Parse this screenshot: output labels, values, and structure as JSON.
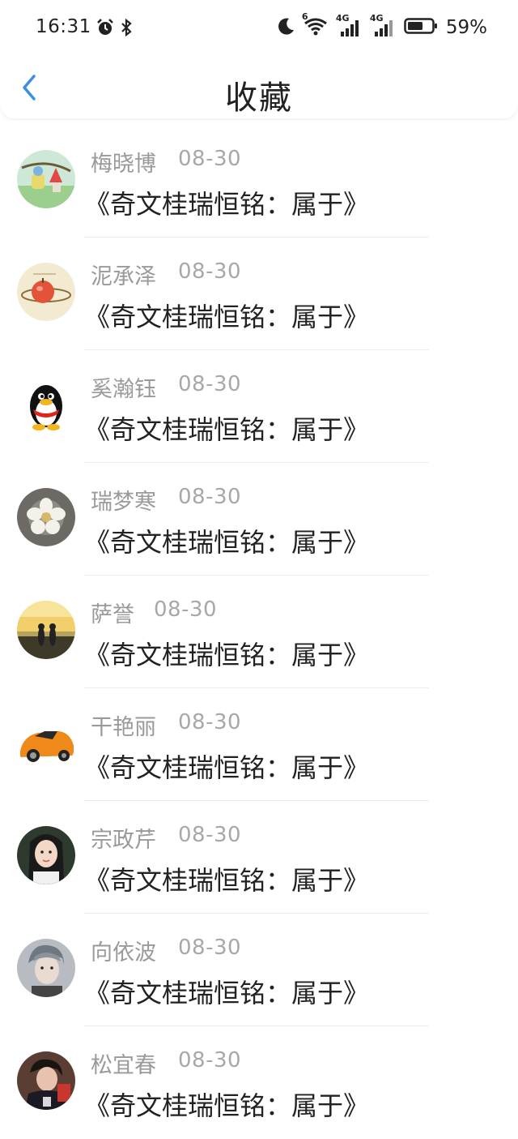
{
  "status_bar": {
    "time": "16:31",
    "battery": "59%",
    "network_1": "4G",
    "network_2": "4G",
    "wifi_label": "6"
  },
  "header": {
    "title": "收藏"
  },
  "items": [
    {
      "name": "梅晓博",
      "date": "08-30",
      "title": "《奇文桂瑞恒铭：属于》"
    },
    {
      "name": "泥承泽",
      "date": "08-30",
      "title": "《奇文桂瑞恒铭：属于》"
    },
    {
      "name": "奚瀚钰",
      "date": "08-30",
      "title": "《奇文桂瑞恒铭：属于》"
    },
    {
      "name": "瑞梦寒",
      "date": "08-30",
      "title": "《奇文桂瑞恒铭：属于》"
    },
    {
      "name": "萨誉",
      "date": "08-30",
      "title": "《奇文桂瑞恒铭：属于》"
    },
    {
      "name": "干艳丽",
      "date": "08-30",
      "title": "《奇文桂瑞恒铭：属于》"
    },
    {
      "name": "宗政芹",
      "date": "08-30",
      "title": "《奇文桂瑞恒铭：属于》"
    },
    {
      "name": "向依波",
      "date": "08-30",
      "title": "《奇文桂瑞恒铭：属于》"
    },
    {
      "name": "松宜春",
      "date": "08-30",
      "title": "《奇文桂瑞恒铭：属于》"
    }
  ],
  "colors": {
    "accent": "#3b8fe0",
    "name_gray": "#9a9a9a",
    "title_text": "#222222"
  }
}
